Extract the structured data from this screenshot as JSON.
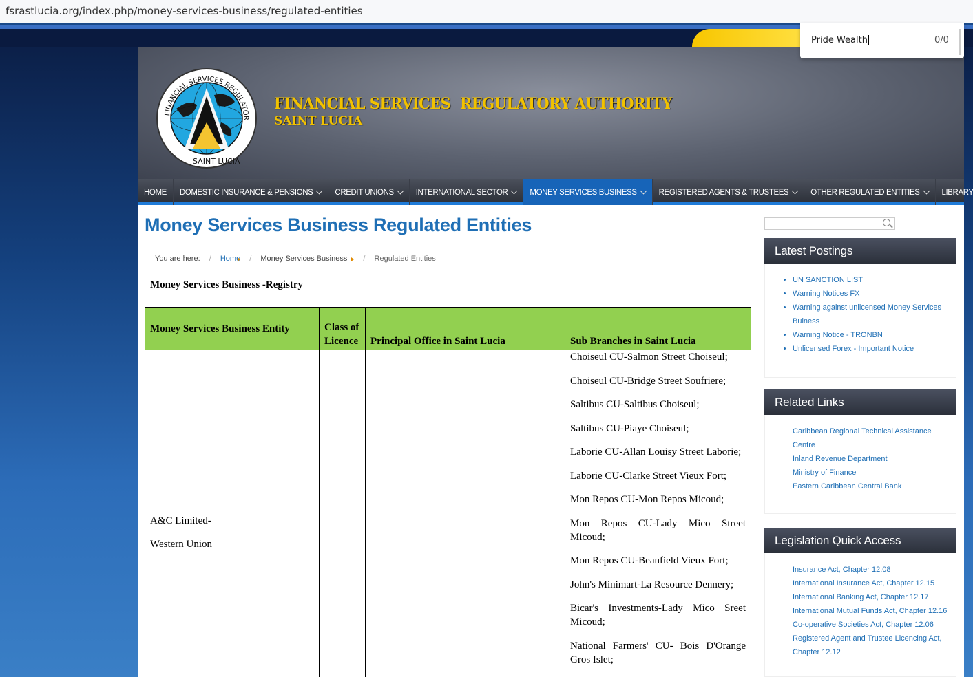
{
  "browser": {
    "url": "fsrastlucia.org/index.php/money-services-business/regulated-entities"
  },
  "find": {
    "query": "Pride Wealth",
    "count": "0/0"
  },
  "header": {
    "title": "FINANCIAL SERVICES  REGULATORY AUTHORITY",
    "subtitle": "SAINT LUCIA",
    "logo_text": "FINANCIAL SERVICES REGULATORY AUTHORITY · SAINT LUCIA"
  },
  "nav": [
    {
      "label": "HOME",
      "dropdown": false
    },
    {
      "label": "DOMESTIC INSURANCE & PENSIONS",
      "dropdown": true
    },
    {
      "label": "CREDIT UNIONS",
      "dropdown": true
    },
    {
      "label": "INTERNATIONAL SECTOR",
      "dropdown": true
    },
    {
      "label": "MONEY SERVICES BUSINESS",
      "dropdown": true
    },
    {
      "label": "REGISTERED AGENTS & TRUSTEES",
      "dropdown": true
    },
    {
      "label": "OTHER REGULATED ENTITIES",
      "dropdown": true
    },
    {
      "label": "LIBRARY",
      "dropdown": true
    }
  ],
  "page": {
    "title": "Money Services Business Regulated Entities",
    "breadcrumb": {
      "prefix": "You are here:",
      "home": "Home",
      "section": "Money Services Business",
      "current": "Regulated Entities"
    },
    "registry_title": "Money Services Business -Registry"
  },
  "table": {
    "headers": [
      "Money Services Business Entity",
      "Class of Licence",
      "Principal Office in Saint Lucia",
      "Sub Branches in Saint Lucia"
    ],
    "rows": [
      {
        "entity": [
          "A&C Limited-",
          "Western Union"
        ],
        "class": "",
        "office": "",
        "branches": [
          "Choiseul CU-Salmon Street Choiseul;",
          "Choiseul CU-Bridge Street Soufriere;",
          "Saltibus CU-Saltibus Choiseul;",
          "Saltibus CU-Piaye Choiseul;",
          "Laborie CU-Allan Louisy Street Laborie;",
          "Laborie CU-Clarke Street Vieux Fort;",
          "Mon Repos CU-Mon Repos Micoud;",
          "Mon Repos CU-Lady Mico Street Micoud;",
          "Mon Repos CU-Beanfield Vieux Fort;",
          "John's Minimart-La Resource Dennery;",
          "Bicar's Investments-Lady Mico Sreet Micoud;",
          "National Farmers' CU- Bois D'Orange Gros Islet;"
        ]
      }
    ]
  },
  "sidebar": {
    "search": {
      "placeholder": ""
    },
    "latest": {
      "title": "Latest Postings",
      "items": [
        "UN SANCTION LIST",
        "Warning Notices FX",
        "Warning against unlicensed Money Services Buiness",
        "Warning Notice - TRONBN",
        "Unlicensed Forex - Important Notice"
      ]
    },
    "related": {
      "title": "Related Links",
      "items": [
        "Caribbean Regional Technical Assistance Centre",
        "Inland Revenue Department",
        "Ministry of Finance",
        "Eastern Caribbean Central Bank"
      ]
    },
    "legislation": {
      "title": "Legislation Quick Access",
      "items": [
        "Insurance Act, Chapter 12.08",
        "International Insurance Act, Chapter 12.15",
        "International Banking Act, Chapter 12.17",
        "International Mutual Funds Act, Chapter 12.16",
        "Co-operative Societies Act, Chapter 12.06",
        "Registered Agent and Trustee Licencing Act, Chapter 12.12"
      ]
    }
  },
  "colors": {
    "accent": "#1f6fb5",
    "nav_active": "#1764b8",
    "table_header": "#92d050",
    "gold": "#f2c200"
  }
}
